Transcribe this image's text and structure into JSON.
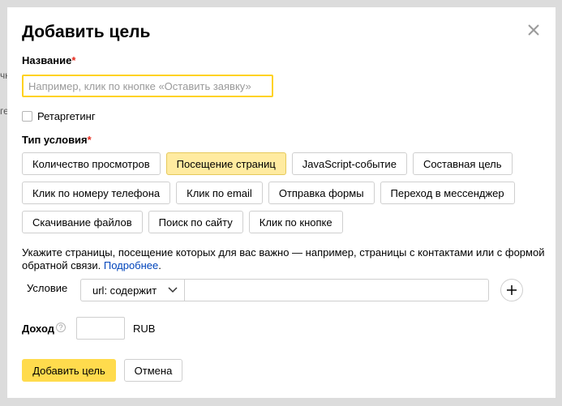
{
  "background": {
    "frag_top": "чн",
    "frag_mid": "ге"
  },
  "dialog": {
    "title": "Добавить цель",
    "name_label": "Название",
    "required_mark": "*",
    "name_placeholder": "Например, клик по кнопке «Оставить заявку»",
    "name_value": "",
    "retargeting_label": "Ретаргетинг",
    "retargeting_checked": false,
    "condition_type_label": "Тип условия",
    "condition_types_row1": [
      "Количество просмотров",
      "Посещение страниц",
      "JavaScript-событие",
      "Составная цель"
    ],
    "condition_types_row2": [
      "Клик по номеру телефона",
      "Клик по email",
      "Отправка формы",
      "Переход в мессенджер"
    ],
    "condition_types_row3": [
      "Скачивание файлов",
      "Поиск по сайту",
      "Клик по кнопке"
    ],
    "selected_condition_type": "Посещение страниц",
    "hint_text": "Укажите страницы, посещение которых для вас важно — например, страницы с контактами или с формой обратной связи. ",
    "hint_link": "Подробнее",
    "hint_tail": ".",
    "condition_label": "Условие",
    "condition_operator": "url: содержит",
    "condition_value": "",
    "income_label": "Доход",
    "income_help": "?",
    "income_value": "",
    "currency": "RUB",
    "submit_label": "Добавить цель",
    "cancel_label": "Отмена"
  },
  "icons": {
    "close": "close-icon",
    "chevron": "chevron-down-icon",
    "add": "plus-icon",
    "help": "question-icon"
  },
  "colors": {
    "accent": "#ffdb4d",
    "selected_chip": "#ffeba0",
    "focus_border": "#ffd21f",
    "required": "#e52a1d",
    "link": "#0044bb"
  }
}
